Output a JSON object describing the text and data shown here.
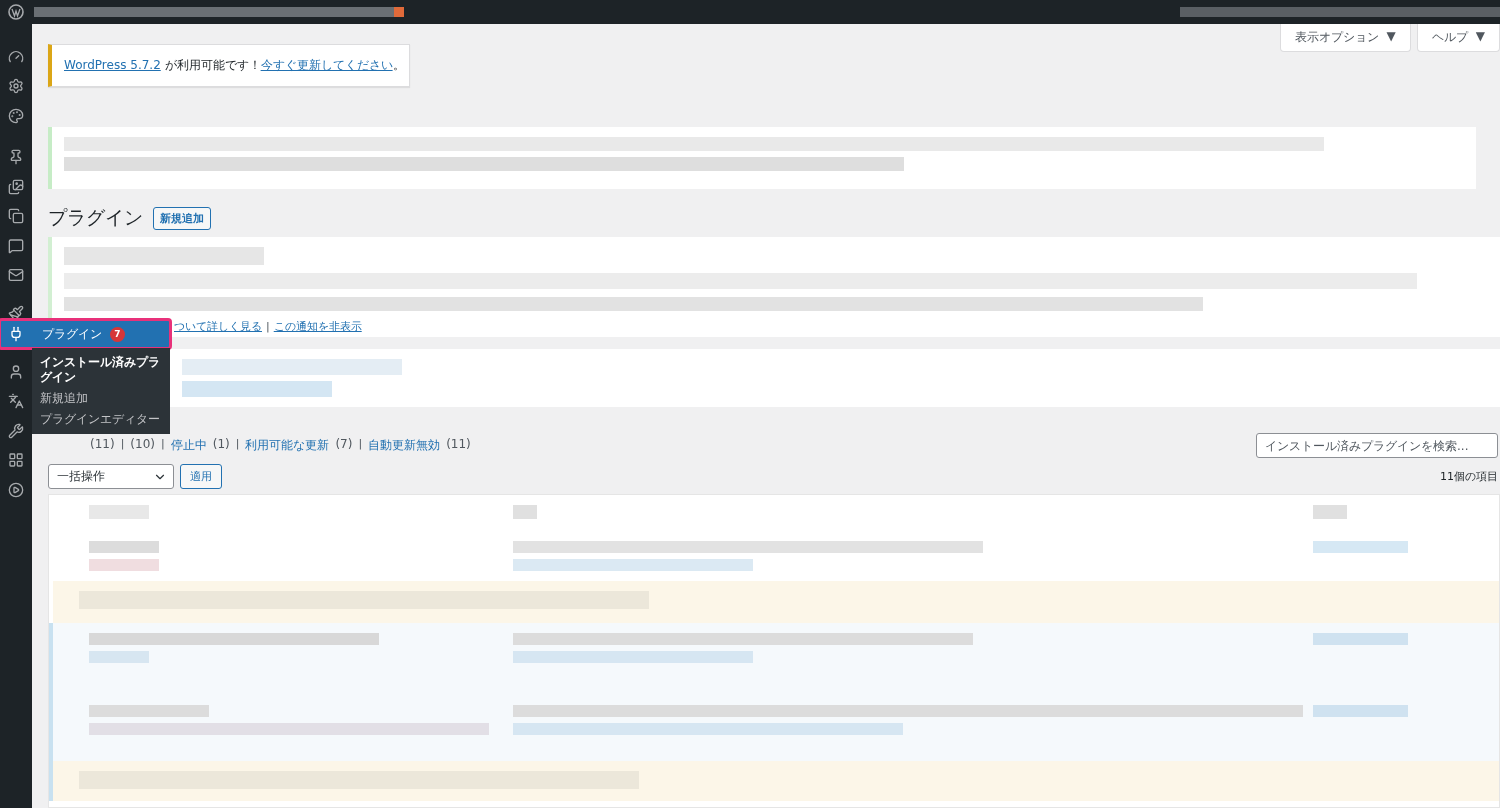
{
  "screen_tabs": [
    {
      "label": "表示オプション",
      "arrow": "▼"
    },
    {
      "label": "ヘルプ",
      "arrow": "▼"
    }
  ],
  "update_notice": {
    "link": "WordPress 5.7.2",
    "text": " が利用可能です！",
    "action": "今すぐ更新してください",
    "end": "。"
  },
  "page": {
    "title": "プラグイン",
    "add_new": "新規追加"
  },
  "notice_links": {
    "learn_more": "ついて詳しく見る",
    "separator": "|",
    "dismiss": "この通知を非表示"
  },
  "filters": [
    {
      "count": "(11)"
    },
    {
      "separator": "|",
      "count": "(10)"
    },
    {
      "separator": "|",
      "label": "停止中",
      "count": "(1)"
    },
    {
      "separator": "|",
      "label": "利用可能な更新",
      "count": "(7)"
    },
    {
      "separator": "|",
      "label": "自動更新無効",
      "count": "(11)"
    }
  ],
  "search": {
    "placeholder": "インストール済みプラグインを検索..."
  },
  "bulk": {
    "value": "一括操作",
    "apply": "適用"
  },
  "item_count": "11個の項目",
  "menu": {
    "label": "プラグイン",
    "badge": "7",
    "highlighted": true,
    "submenu": [
      {
        "label": "インストール済みプラグイン",
        "selected": true
      },
      {
        "label": "新規追加",
        "selected": false
      },
      {
        "label": "プラグインエディター",
        "selected": false
      }
    ]
  }
}
